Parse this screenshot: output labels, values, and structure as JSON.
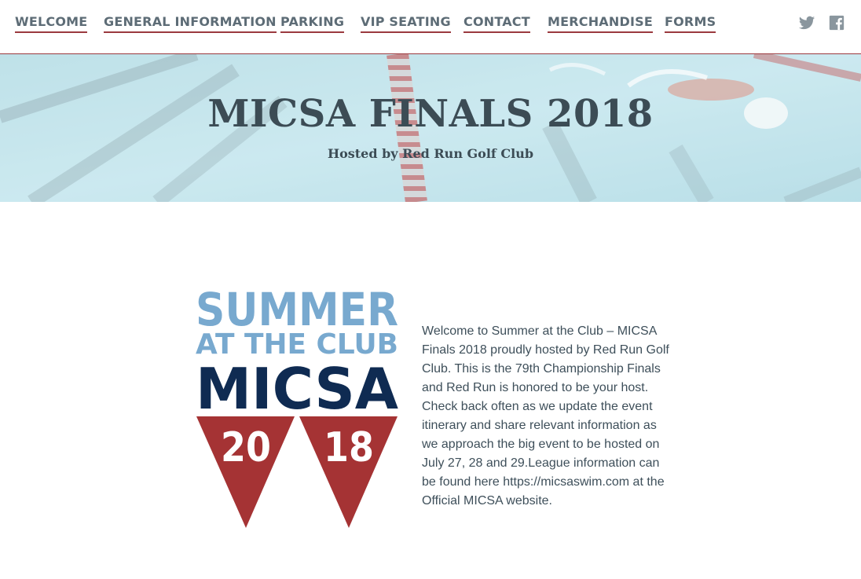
{
  "nav": {
    "items": [
      {
        "label": "WELCOME"
      },
      {
        "label": "GENERAL INFORMATION"
      },
      {
        "label": "PARKING"
      },
      {
        "label": "VIP SEATING"
      },
      {
        "label": "CONTACT"
      },
      {
        "label": "MERCHANDISE"
      },
      {
        "label": "FORMS"
      }
    ],
    "social": [
      {
        "icon": "twitter-icon"
      },
      {
        "icon": "facebook-icon"
      }
    ]
  },
  "hero": {
    "title": "MICSA FINALS 2018",
    "subtitle": "Hosted by Red Run Golf Club"
  },
  "logo": {
    "line1": "SUMMER",
    "line2": "AT THE CLUB",
    "line3": "MICSA",
    "year_left": "20",
    "year_right": "18"
  },
  "welcome": {
    "text": "Welcome to Summer at the Club – MICSA Finals 2018 proudly hosted by Red Run Golf Club.  This is the 79th Championship Finals and Red Run is honored to be your host.  Check back often as we update the event itinerary and share relevant information as we approach the big event to be hosted on July 27, 28 and 29.League information can be found here https://micsaswim.com at the Official MICSA website."
  },
  "colors": {
    "accent_red": "#a53334",
    "navy": "#0f2b52",
    "light_blue": "#78a9cf",
    "nav_text": "#5d6c76"
  }
}
